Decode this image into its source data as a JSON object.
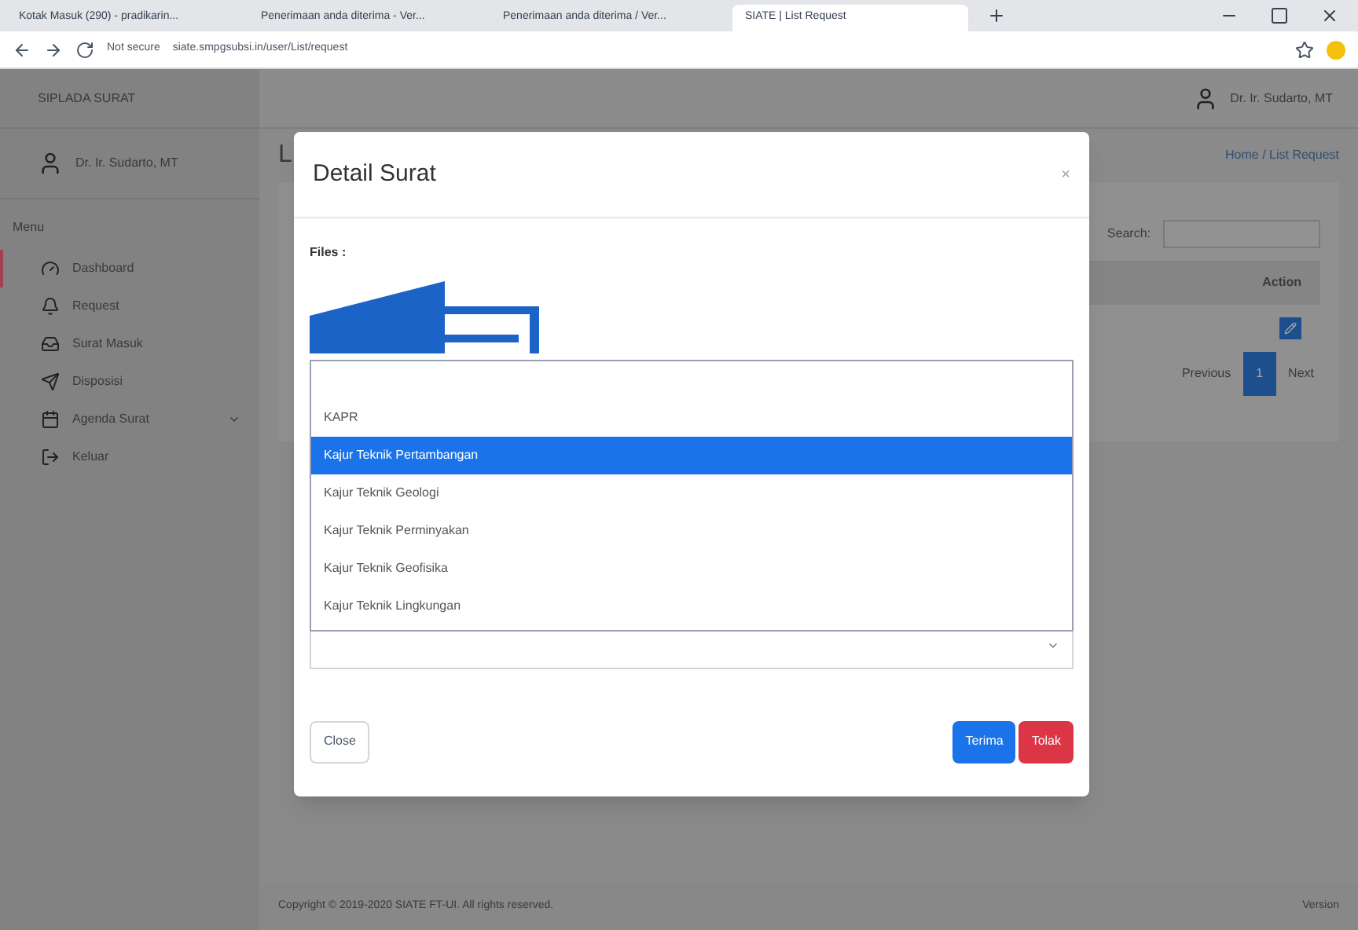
{
  "browser": {
    "tabs": [
      {
        "title": "Kotak Masuk (290) - pradikarin...",
        "selected": false
      },
      {
        "title": "Penerimaan anda diterima - Ver...",
        "selected": false
      },
      {
        "title": "Penerimaan anda diterima / Ver...",
        "selected": false
      },
      {
        "title": "SIATE | List Request",
        "selected": true
      }
    ],
    "security": "Not secure",
    "url": "siate.smpgsubsi.in/user/List/request"
  },
  "sidebar": {
    "brand": "SIPLADA SURAT",
    "user": "Dr. Ir. Sudarto, MT",
    "menu_label": "Menu",
    "items": [
      {
        "label": "Dashboard",
        "selected": true,
        "has_children": false
      },
      {
        "label": "Request",
        "selected": false,
        "has_children": false
      },
      {
        "label": "Surat Masuk",
        "selected": false,
        "has_children": false
      },
      {
        "label": "Disposisi",
        "selected": false,
        "has_children": false
      },
      {
        "label": "Agenda Surat",
        "selected": false,
        "has_children": true
      },
      {
        "label": "Keluar",
        "selected": false,
        "has_children": false
      }
    ]
  },
  "header": {
    "user": "Dr. Ir. Sudarto, MT"
  },
  "page": {
    "title": "L",
    "breadcrumb": "Home / List Request",
    "search_label": "Search:",
    "columns": [
      "Action"
    ],
    "pagination": [
      "Previous",
      "1",
      "Next"
    ]
  },
  "modal": {
    "title": "Detail Surat",
    "close": "×",
    "files_label": "Files :",
    "dropdown": {
      "options": [
        {
          "label": "KAPR",
          "selected": false
        },
        {
          "label": "Kajur Teknik Pertambangan",
          "selected": true
        },
        {
          "label": "Kajur Teknik Geologi",
          "selected": false
        },
        {
          "label": "Kajur Teknik Perminyakan",
          "selected": false
        },
        {
          "label": "Kajur Teknik Geofisika",
          "selected": false
        },
        {
          "label": "Kajur Teknik Lingkungan",
          "selected": false
        }
      ]
    },
    "buttons": [
      {
        "label": "Close",
        "kind": "secondary"
      },
      {
        "label": "Terima",
        "kind": "primary"
      },
      {
        "label": "Tolak",
        "kind": "danger"
      }
    ]
  },
  "footer": {
    "copyright": "Copyright © 2019-2020 SIATE FT-UI. All rights reserved.",
    "version": "Version"
  }
}
